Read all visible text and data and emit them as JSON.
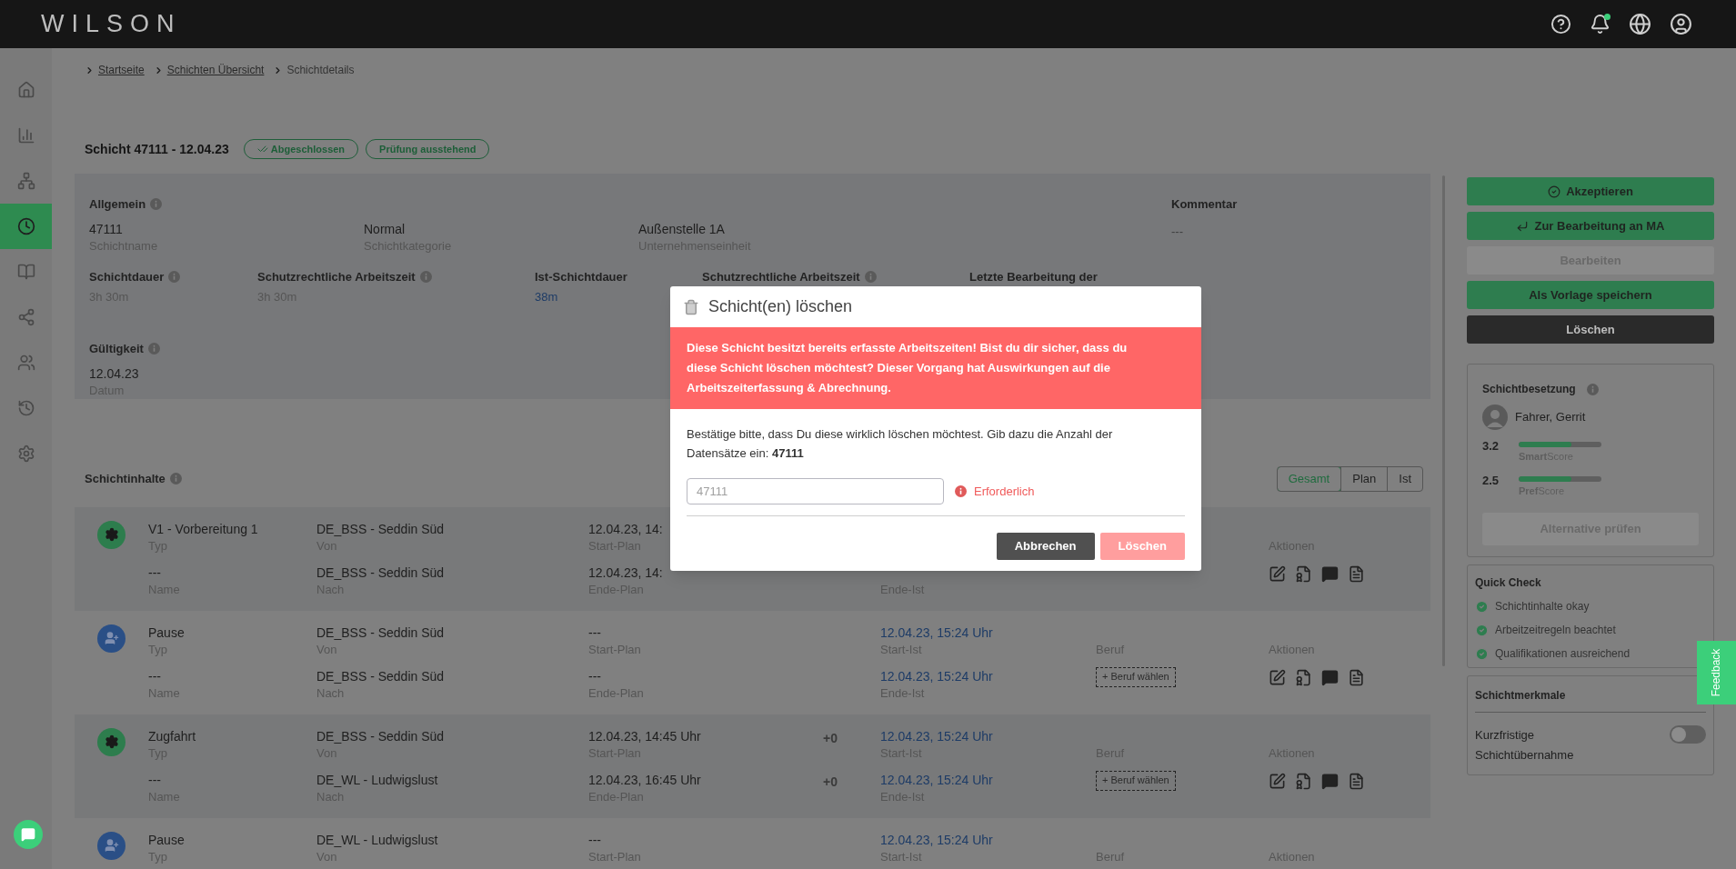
{
  "topbar": {
    "brand": "WILSON",
    "notification": true
  },
  "sidebar": {
    "items": [
      {
        "selected": false
      },
      {
        "selected": false
      },
      {
        "selected": false
      },
      {
        "selected": true
      },
      {
        "selected": false
      },
      {
        "selected": false
      },
      {
        "selected": false
      },
      {
        "selected": false
      },
      {
        "selected": false
      }
    ]
  },
  "breadcrumb": [
    {
      "label": "Startseite",
      "kind": "link"
    },
    {
      "label": "Schichten Übersicht",
      "kind": "link"
    },
    {
      "label": "Schichtdetails",
      "kind": "current"
    }
  ],
  "header": {
    "title": "Schicht 47111 - 12.04.23",
    "badges": [
      {
        "label": "Abgeschlossen",
        "kind": "check"
      },
      {
        "label": "Prüfung ausstehend",
        "kind": "plain"
      }
    ]
  },
  "general": {
    "heading": "Allgemein",
    "fields": [
      {
        "value": "47111",
        "label": "Schichtname"
      },
      {
        "value": "Normal",
        "label": "Schichtkategorie"
      },
      {
        "value": "Außenstelle 1A",
        "label": "Unternehmenseinheit"
      }
    ],
    "comment": {
      "heading": "Kommentar",
      "value": "---"
    }
  },
  "durations": [
    {
      "heading": "Schichtdauer",
      "info": true,
      "value": "3h 30m",
      "kind": "plan"
    },
    {
      "heading": "Schutzrechtliche Arbeitszeit",
      "info": true,
      "value": "3h 30m",
      "kind": "plan"
    },
    {
      "heading": "Ist-Schichtdauer",
      "info": false,
      "value": "38m",
      "kind": "actual"
    },
    {
      "heading": "Schutzrechtliche Arbeitszeit",
      "info": true
    },
    {
      "heading": "Letzte Bearbeitung der",
      "info": false
    }
  ],
  "validity": {
    "heading": "Gültigkeit",
    "value": "12.04.23",
    "label": "Datum"
  },
  "contents": {
    "heading": "Schichtinhalte",
    "filters": [
      {
        "label": "Gesamt",
        "selected": true
      },
      {
        "label": "Plan",
        "selected": false
      },
      {
        "label": "Ist",
        "selected": false
      }
    ],
    "rows": [
      {
        "kind": "task",
        "type": "V1 - Vorbereitung 1",
        "type_label": "Typ",
        "name": "---",
        "name_label": "Name",
        "from": "DE_BSS - Seddin Süd",
        "from_label": "Von",
        "to": "DE_BSS - Seddin Süd",
        "to_label": "Nach",
        "start_plan": "12.04.23, 14:",
        "start_plan_label": "Start-Plan",
        "end_plan": "12.04.23, 14:",
        "end_plan_label": "Ende-Plan",
        "end_ist_label": "Ende-Ist",
        "actions_label": "Aktionen"
      },
      {
        "kind": "break",
        "type": "Pause",
        "type_label": "Typ",
        "name": "---",
        "name_label": "Name",
        "from": "DE_BSS - Seddin Süd",
        "from_label": "Von",
        "to": "DE_BSS - Seddin Süd",
        "to_label": "Nach",
        "start_plan": "---",
        "start_plan_label": "Start-Plan",
        "end_plan": "---",
        "end_plan_label": "Ende-Plan",
        "start_ist": "12.04.23, 15:24 Uhr",
        "start_ist_label": "Start-Ist",
        "end_ist": "12.04.23, 15:24 Uhr",
        "end_ist_label": "Ende-Ist",
        "beruf_label": "Beruf",
        "beruf_button": "+ Beruf wählen",
        "actions_label": "Aktionen"
      },
      {
        "kind": "task",
        "type": "Zugfahrt",
        "type_label": "Typ",
        "name": "---",
        "name_label": "Name",
        "from": "DE_BSS - Seddin Süd",
        "from_label": "Von",
        "to": "DE_WL - Ludwigslust",
        "to_label": "Nach",
        "start_plan": "12.04.23, 14:45 Uhr",
        "start_plan_label": "Start-Plan",
        "end_plan": "12.04.23, 16:45 Uhr",
        "end_plan_label": "Ende-Plan",
        "start_delta": "+0",
        "end_delta": "+0",
        "start_ist": "12.04.23, 15:24 Uhr",
        "start_ist_label": "Start-Ist",
        "end_ist": "12.04.23, 15:24 Uhr",
        "end_ist_label": "Ende-Ist",
        "beruf_label": "Beruf",
        "beruf_button": "+ Beruf wählen",
        "actions_label": "Aktionen"
      },
      {
        "kind": "break",
        "type": "Pause",
        "type_label": "Typ",
        "from": "DE_WL - Ludwigslust",
        "from_label": "Von",
        "start_plan": "---",
        "start_plan_label": "Start-Plan",
        "start_ist": "12.04.23, 15:24 Uhr",
        "start_ist_label": "Start-Ist",
        "beruf_label": "Beruf",
        "actions_label": "Aktionen"
      }
    ]
  },
  "actions": [
    {
      "label": "Akzeptieren",
      "kind": "primary"
    },
    {
      "label": "Zur Bearbeitung an MA",
      "kind": "primary"
    },
    {
      "label": "Bearbeiten",
      "kind": "disabled"
    },
    {
      "label": "Als Vorlage speichern",
      "kind": "primary"
    },
    {
      "label": "Löschen",
      "kind": "dark"
    }
  ],
  "assignment": {
    "heading": "Schichtbesetzung",
    "person": "Fahrer, Gerrit",
    "scores": [
      {
        "value": "3.2",
        "label": "**Smart**Score",
        "level": 0.64
      },
      {
        "value": "2.5",
        "label": "**Pref**Score",
        "level": 0.64
      }
    ],
    "button": "Alternative prüfen"
  },
  "quick_check": {
    "heading": "Quick Check",
    "items": [
      {
        "label": "Schichtinhalte okay",
        "ok": true
      },
      {
        "label": "Arbeitzeitregeln beachtet",
        "ok": true
      },
      {
        "label": "Qualifikationen ausreichend",
        "ok": true
      }
    ]
  },
  "features": {
    "heading": "Schichtmerkmale",
    "items": [
      {
        "label": "Kurzfristige Schichtübernahme",
        "on": false
      }
    ]
  },
  "feedback": "Feedback",
  "modal": {
    "title": "Schicht(en) löschen",
    "warning": "Diese Schicht besitzt bereits erfasste Arbeitszeiten! Bist du dir sicher, dass du diese Schicht löschen möchtest? Dieser Vorgang hat Auswirkungen auf die Arbeitszeiterfassung & Abrechnung.",
    "prompt": "Bestätige bitte, dass Du diese wirklich löschen möchtest. Gib dazu die Anzahl der Datensätze ein: **47111**",
    "input": {
      "placeholder": "47111"
    },
    "error": "Erforderlich",
    "buttons": [
      {
        "label": "Abbrechen",
        "kind": "secondary",
        "disabled": false
      },
      {
        "label": "Löschen",
        "kind": "danger",
        "disabled": true
      }
    ]
  }
}
